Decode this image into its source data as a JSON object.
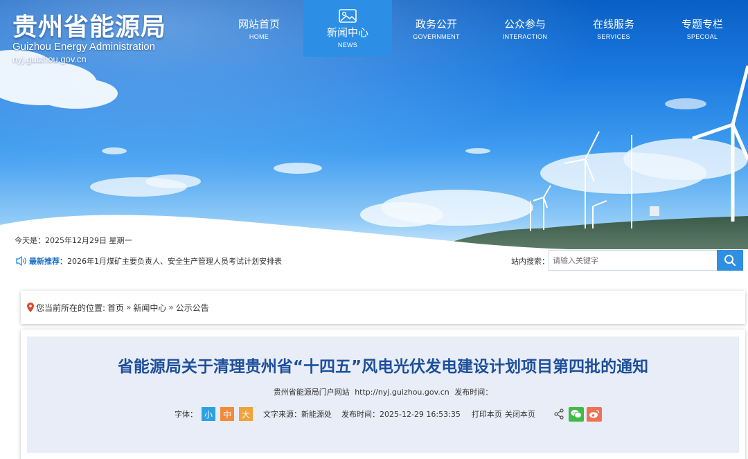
{
  "site": {
    "name_cn": "贵州省能源局",
    "name_en": "Guizhou Energy Administration",
    "url": "nyj.guizhou.gov.cn"
  },
  "nav": [
    {
      "cn": "网站首页",
      "en": "HOME",
      "active": false
    },
    {
      "cn": "新闻中心",
      "en": "NEWS",
      "active": true,
      "icon": "picture-icon"
    },
    {
      "cn": "政务公开",
      "en": "GOVERNMENT",
      "active": false
    },
    {
      "cn": "公众参与",
      "en": "INTERACTION",
      "active": false
    },
    {
      "cn": "在线服务",
      "en": "SERVICES",
      "active": false
    },
    {
      "cn": "专题专栏",
      "en": "SPECOAL",
      "active": false
    }
  ],
  "today": "今天是：2025年12月29日 星期一",
  "notice": {
    "icon": "speaker-icon",
    "tag": "最新推荐：",
    "text": "2026年1月煤矿主要负责人、安全生产管理人员考试计划安排表"
  },
  "search": {
    "label": "站内搜索：",
    "placeholder": "请输入关键字",
    "button_icon": "search-icon"
  },
  "breadcrumb": {
    "prefix": "您当前所在的位置:",
    "items": [
      "首页",
      "新闻中心",
      "公示公告"
    ],
    "separator": "»"
  },
  "article": {
    "title": "省能源局关于清理贵州省“十四五”风电光伏发电建设计划项目第四批的通知",
    "source_site": "贵州省能源局门户网站",
    "source_url": "http://nyj.guizhou.gov.cn",
    "publish_label": "发布时间：",
    "font_label": "字体：",
    "font_sizes": [
      "小",
      "中",
      "大"
    ],
    "origin_label": "文字来源：新能源处",
    "time_label": "发布时间：2025-12-29 16:53:35",
    "print": "打印本页",
    "close": "关闭本页"
  },
  "colors": {
    "nav_active": "#2d8ee6",
    "title": "#1e4f9b",
    "search_button": "#2f8fe2",
    "accent_blue": "#1a6fc7"
  }
}
